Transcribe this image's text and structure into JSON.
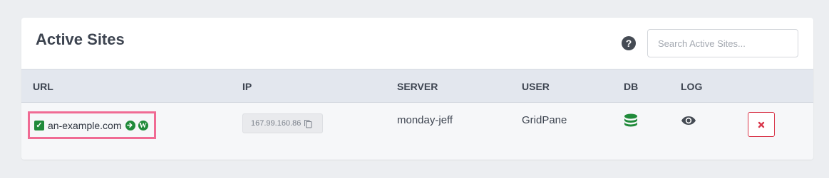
{
  "panel": {
    "title": "Active Sites",
    "help_glyph": "?",
    "search": {
      "placeholder": "Search Active Sites...",
      "value": ""
    }
  },
  "table": {
    "columns": [
      "URL",
      "IP",
      "SERVER",
      "USER",
      "DB",
      "LOG"
    ],
    "rows": [
      {
        "url": "an-example.com",
        "ip": "167.99.160.86",
        "server": "monday-jeff",
        "user": "GridPane",
        "db_icon": "database-icon",
        "log_icon": "eye-icon",
        "delete_icon": "close-icon"
      }
    ]
  },
  "colors": {
    "background": "#eceef1",
    "header_row": "#e3e7ee",
    "highlight_border": "#f06b94",
    "success_green": "#208a3a",
    "danger_red": "#d9374b"
  }
}
